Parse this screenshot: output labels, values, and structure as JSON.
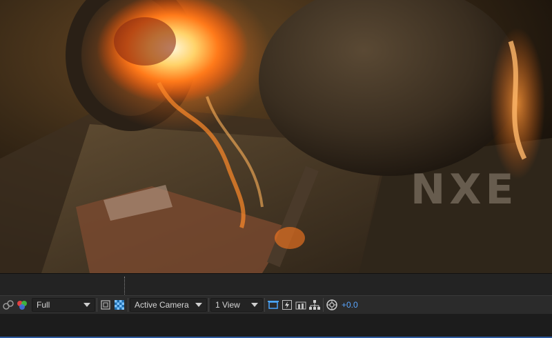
{
  "toolbar": {
    "resolution": {
      "selected": "Full"
    },
    "camera": {
      "selected": "Active Camera"
    },
    "views": {
      "selected": "1 View"
    },
    "exposure_value": "+0.0"
  },
  "viewer": {
    "overlay_text": "NXE"
  },
  "colors": {
    "toolbar_bg": "#2b2b2b",
    "accent_blue": "#5aa6ff",
    "bottom_line": "#2c5aa0"
  }
}
